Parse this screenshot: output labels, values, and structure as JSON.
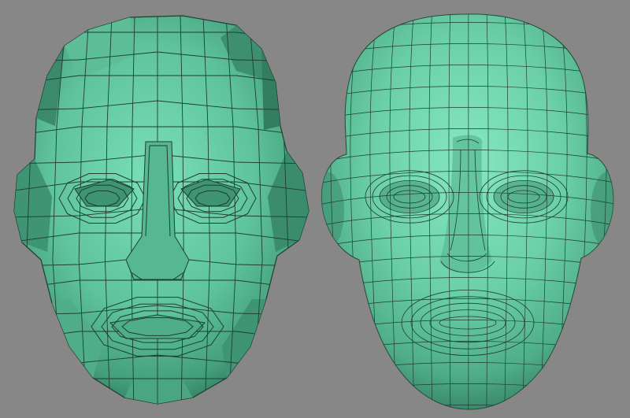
{
  "scene": {
    "background_color": "#878787",
    "mesh_color": "#66c9a3",
    "mesh_shadow_color": "#2f7a5c",
    "wire_color": "#1f3d31"
  },
  "models": [
    {
      "name": "low-poly-head",
      "shading": "flat",
      "side": "left"
    },
    {
      "name": "subdivided-head",
      "shading": "smooth",
      "side": "right"
    }
  ]
}
